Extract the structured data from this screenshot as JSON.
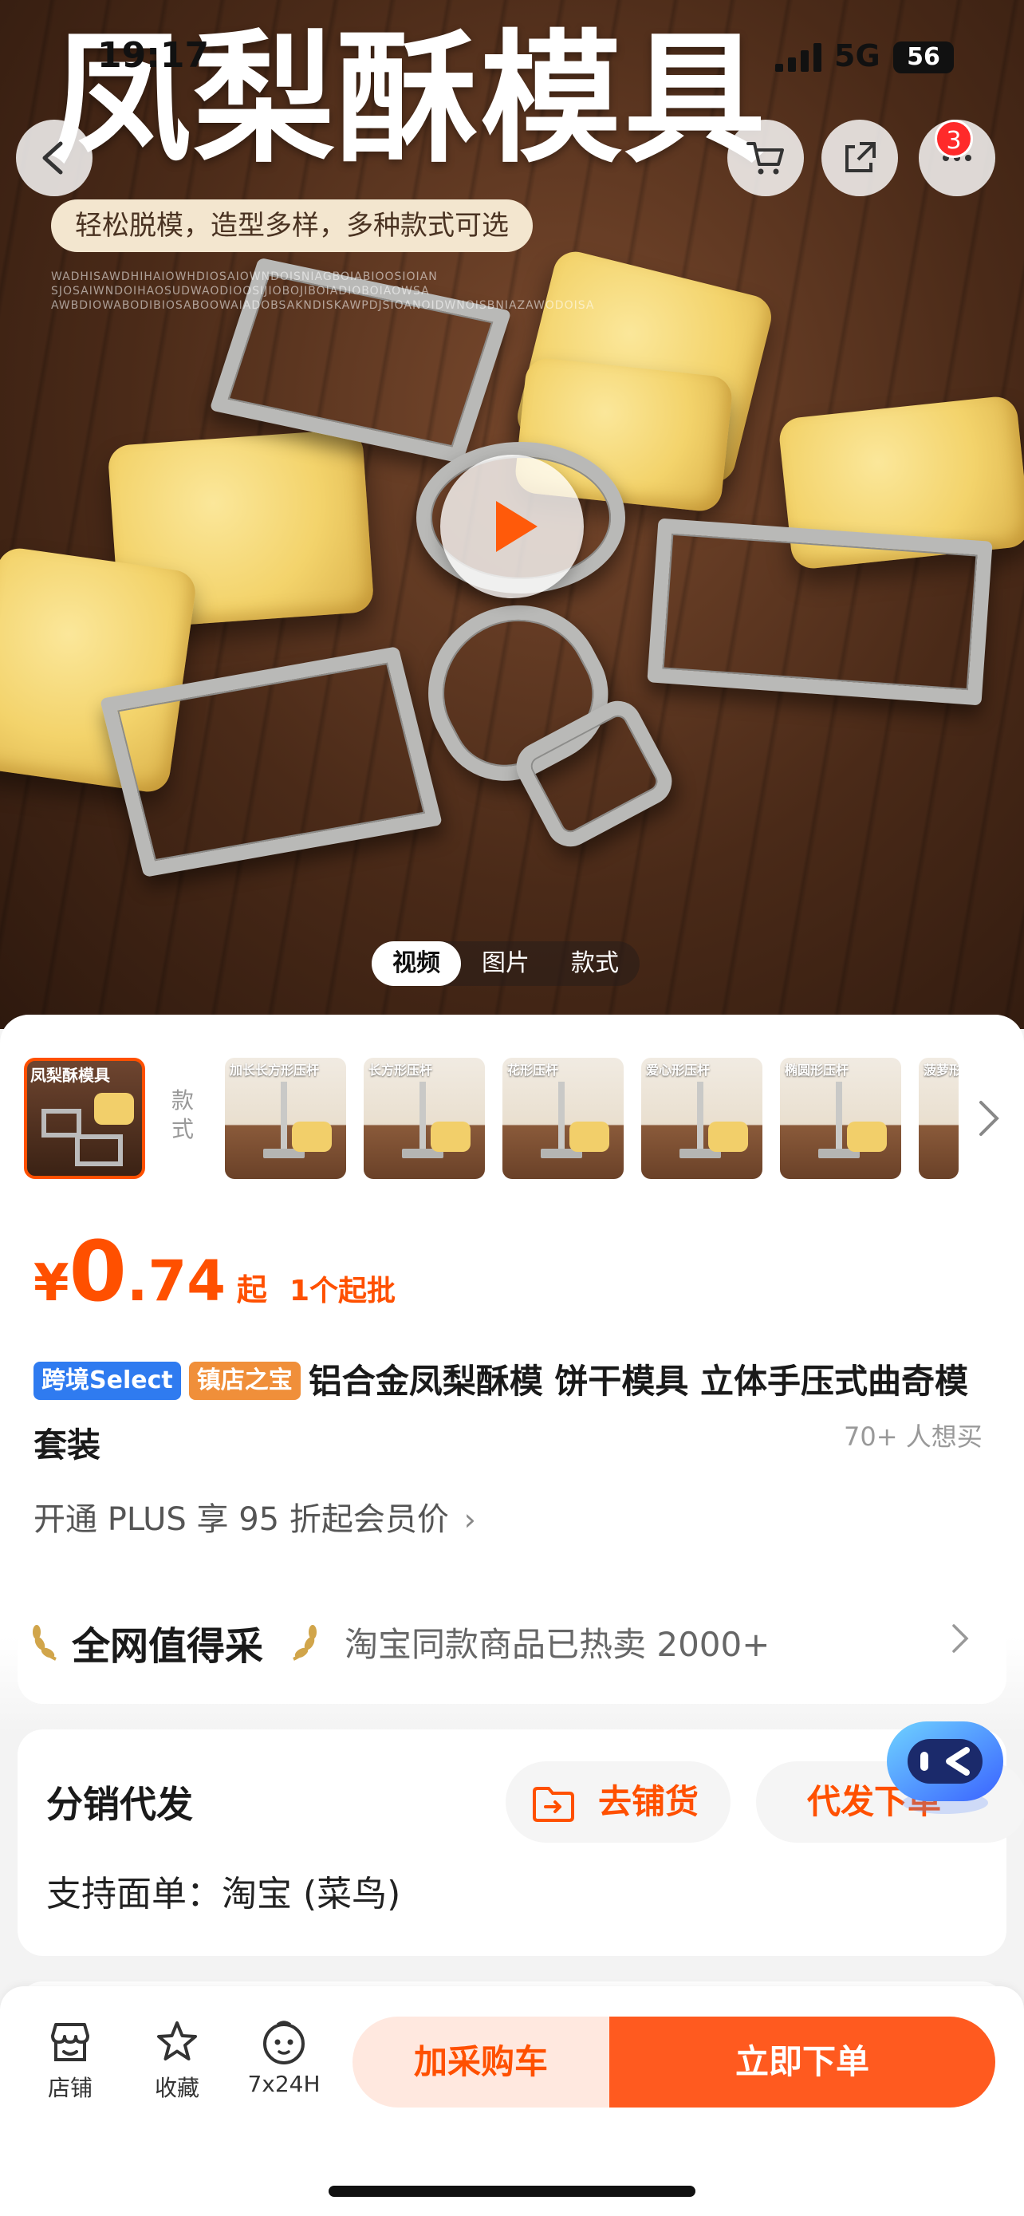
{
  "status_bar": {
    "time": "19:17",
    "network": "5G",
    "battery": "56"
  },
  "hero": {
    "title": "凤梨酥模具",
    "subtitle": "轻松脱模，造型多样，多种款式可选",
    "tiny_text": "WADHISAWDHIHAIOWHDIOSAIOWNDOISNIAGBOIABIOOSIOIAN SJOSAIWNDOIHAOSUDWAODIOOSIJIOBOJIBOIADIOBOIAOWSA AWBDIOWABODIBIOSABOOWAIADOBSAKNDISKAWPDJSIOANOIDWNOISBNIAZAWODOISA",
    "cart_badge": "3",
    "media_tabs": [
      "视频",
      "图片",
      "款式"
    ]
  },
  "thumbs": {
    "main_label": "凤梨酥模具",
    "vertical_label": "款式",
    "items": [
      "加长长方形压杆",
      "长方形压杆",
      "花形压杆",
      "爱心形压杆",
      "椭圆形压杆",
      "菠萝形"
    ]
  },
  "price": {
    "symbol": "¥",
    "integer": "0",
    "decimal": ".74",
    "suffix": "起",
    "min_order": "1个起批"
  },
  "product": {
    "tag_select": "跨境Select",
    "tag_treasure": "镇店之宝",
    "title": "铝合金凤梨酥模 饼干模具 立体手压式曲奇模套装",
    "want": "70+ 人想买",
    "plus": "开通 PLUS 享 95 折起会员价"
  },
  "card_recommend": {
    "title": "全网值得采",
    "desc": "淘宝同款商品已热卖 2000+"
  },
  "card_distribution": {
    "title": "分销代发",
    "btn_stock": "去铺货",
    "btn_dropship": "代发下单",
    "support": "支持面单：淘宝 (菜鸟)"
  },
  "bottom_bar": {
    "shop": "店铺",
    "favorite": "收藏",
    "service": "7x24H",
    "add_cart": "加采购车",
    "buy_now": "立即下单"
  },
  "colors": {
    "accent": "#ff5000",
    "accent_light": "#ffe8df",
    "blue_tag": "#2f7bf0",
    "orange_tag": "#f08f3a"
  }
}
